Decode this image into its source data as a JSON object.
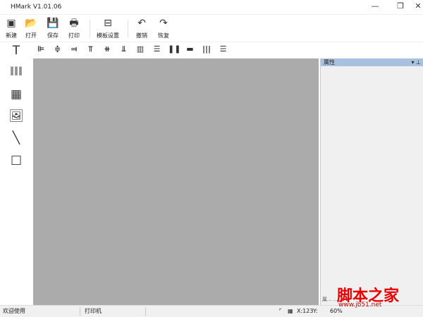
{
  "window": {
    "title": "HMark V1.01.06"
  },
  "toolbar": [
    {
      "label": "新建",
      "icon": "new-file-icon"
    },
    {
      "label": "打开",
      "icon": "folder-open-icon"
    },
    {
      "label": "保存",
      "icon": "save-icon"
    },
    {
      "label": "打印",
      "icon": "print-icon"
    },
    {
      "label": "模板设置",
      "icon": "template-settings-icon"
    },
    {
      "label": "撤销",
      "icon": "undo-icon"
    },
    {
      "label": "恢复",
      "icon": "redo-icon"
    }
  ],
  "align_tools": [
    "align-left",
    "align-center-h",
    "align-right",
    "align-top",
    "align-center-v",
    "align-bottom",
    "same-width",
    "same-height",
    "distribute-h",
    "distribute-v",
    "same-size",
    "bring-front"
  ],
  "left_tools": [
    "text-tool",
    "barcode-tool",
    "qrcode-tool",
    "image-tool",
    "line-tool",
    "rectangle-tool"
  ],
  "panel": {
    "title": "属性",
    "tabs": [
      "属...",
      "...",
      "..."
    ]
  },
  "status": {
    "welcome": "欢迎使用",
    "printer": "打印机",
    "x": "X:123",
    "y": "Y:",
    "zoom": "60%"
  },
  "watermark": {
    "text": "脚本之家",
    "url": "www.jb51.net"
  }
}
